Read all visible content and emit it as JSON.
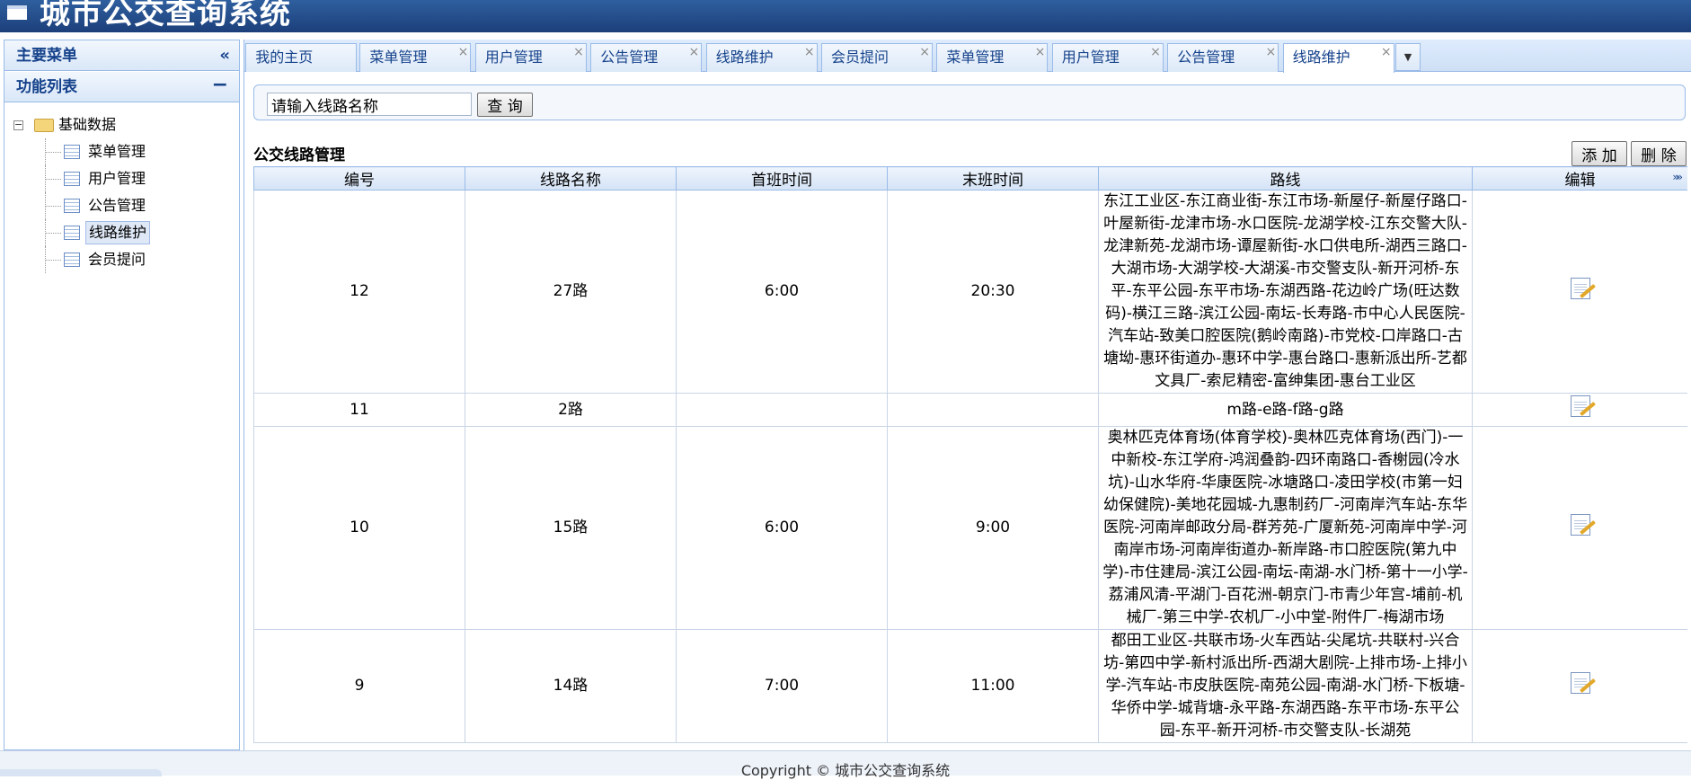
{
  "app": {
    "title": "城市公交查询系统"
  },
  "sidebar": {
    "main_menu": "主要菜单",
    "collapse_glyph": "«",
    "function_list": "功能列表",
    "function_list_glyph": "−",
    "tree": {
      "root": "基础数据",
      "items": [
        {
          "label": "菜单管理",
          "selected": false
        },
        {
          "label": "用户管理",
          "selected": false
        },
        {
          "label": "公告管理",
          "selected": false
        },
        {
          "label": "线路维护",
          "selected": true
        },
        {
          "label": "会员提问",
          "selected": false
        }
      ]
    }
  },
  "tabs": [
    {
      "label": "我的主页",
      "closable": false
    },
    {
      "label": "菜单管理",
      "closable": true
    },
    {
      "label": "用户管理",
      "closable": true
    },
    {
      "label": "公告管理",
      "closable": true
    },
    {
      "label": "线路维护",
      "closable": true
    },
    {
      "label": "会员提问",
      "closable": true
    },
    {
      "label": "菜单管理",
      "closable": true
    },
    {
      "label": "用户管理",
      "closable": true
    },
    {
      "label": "公告管理",
      "closable": true
    },
    {
      "label": "线路维护",
      "closable": true,
      "active": true
    }
  ],
  "tab_more_glyph": "▼",
  "search": {
    "value": "请输入线路名称",
    "button": "查 询"
  },
  "grid": {
    "title": "公交线路管理",
    "add_button": "添 加",
    "delete_button": "删 除",
    "columns": [
      "编号",
      "线路名称",
      "首班时间",
      "末班时间",
      "路线",
      "编辑"
    ],
    "expand_glyph": "»»",
    "rows": [
      {
        "id": "12",
        "name": "27路",
        "first": "6:00",
        "last": "20:30",
        "route": "东江工业区-东江商业街-东江市场-新屋仔-新屋仔路口-叶屋新街-龙津市场-水口医院-龙湖学校-江东交警大队-龙津新苑-龙湖市场-谭屋新街-水口供电所-湖西三路口-大湖市场-大湖学校-大湖溪-市交警支队-新开河桥-东平-东平公园-东平市场-东湖西路-花边岭广场(旺达数码)-横江三路-滨江公园-南坛-长寿路-市中心人民医院-汽车站-致美口腔医院(鹅岭南路)-市党校-口岸路口-古塘坳-惠环街道办-惠环中学-惠台路口-惠新派出所-艺都文具厂-索尼精密-富绅集团-惠台工业区"
      },
      {
        "id": "11",
        "name": "2路",
        "first": "",
        "last": "",
        "route": "m路-e路-f路-g路"
      },
      {
        "id": "10",
        "name": "15路",
        "first": "6:00",
        "last": "9:00",
        "route": "奥林匹克体育场(体育学校)-奥林匹克体育场(西门)-一中新校-东江学府-鸿润叠韵-四环南路口-香榭园(冷水坑)-山水华府-华康医院-冰塘路口-凌田学校(市第一妇幼保健院)-美地花园城-九惠制药厂-河南岸汽车站-东华医院-河南岸邮政分局-群芳苑-广厦新苑-河南岸中学-河南岸市场-河南岸街道办-新岸路-市口腔医院(第九中学)-市住建局-滨江公园-南坛-南湖-水门桥-第十一小学-荔浦风清-平湖门-百花洲-朝京门-市青少年宫-埔前-机械厂-第三中学-农机厂-小中堂-附件厂-梅湖市场"
      },
      {
        "id": "9",
        "name": "14路",
        "first": "7:00",
        "last": "11:00",
        "route": "都田工业区-共联市场-火车西站-尖尾坑-共联村-兴合坊-第四中学-新村派出所-西湖大剧院-上排市场-上排小学-汽车站-市皮肤医院-南苑公园-南湖-水门桥-下板塘-华侨中学-城背塘-永平路-东湖西路-东平市场-东平公园-东平-新开河桥-市交警支队-长湖苑"
      }
    ]
  },
  "footer": {
    "text": "Copyright © 城市公交查询系统"
  }
}
